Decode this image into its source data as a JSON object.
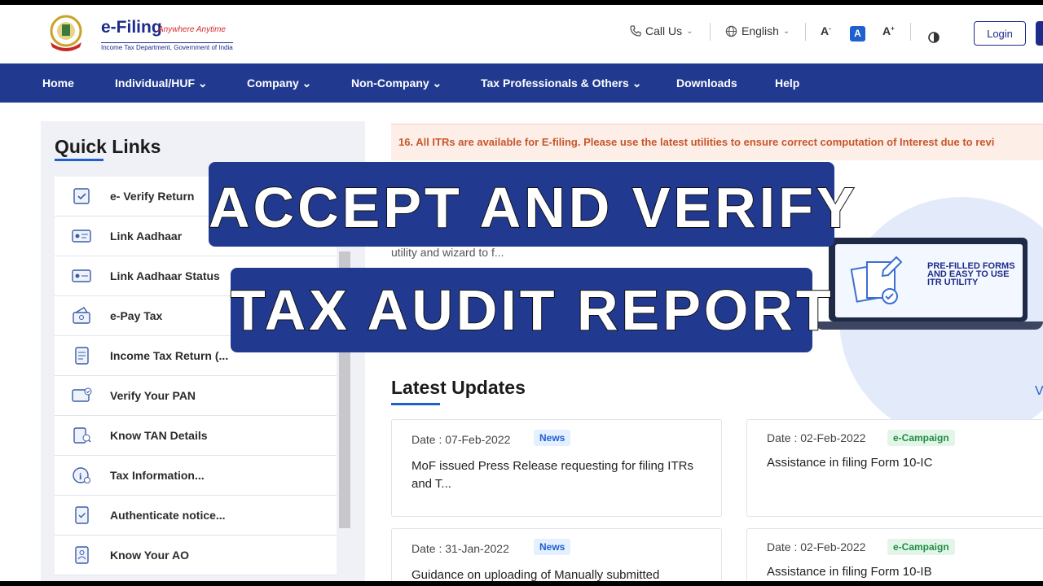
{
  "header": {
    "logo_title": "e-Filing",
    "logo_tagline": "Anywhere Anytime",
    "logo_subtitle": "Income Tax Department, Government of India",
    "call_us": "Call Us",
    "language": "English",
    "font_decrease": "A",
    "font_normal": "A",
    "font_increase": "A",
    "login": "Login"
  },
  "nav": {
    "items": [
      {
        "label": "Home"
      },
      {
        "label": "Individual/HUF ⌄"
      },
      {
        "label": "Company ⌄"
      },
      {
        "label": "Non-Company ⌄"
      },
      {
        "label": "Tax Professionals & Others ⌄"
      },
      {
        "label": "Downloads"
      },
      {
        "label": "Help"
      }
    ]
  },
  "quick_links": {
    "title": "Quick Links",
    "items": [
      {
        "label": "e- Verify Return",
        "icon": "verify-return-icon"
      },
      {
        "label": "Link Aadhaar",
        "icon": "aadhaar-card-icon"
      },
      {
        "label": "Link Aadhaar Status",
        "icon": "aadhaar-status-icon"
      },
      {
        "label": "e-Pay Tax",
        "icon": "pay-tax-icon"
      },
      {
        "label": "Income Tax Return (...",
        "icon": "return-document-icon"
      },
      {
        "label": "Verify Your PAN",
        "icon": "pan-card-icon"
      },
      {
        "label": "Know TAN Details",
        "icon": "tan-document-icon"
      },
      {
        "label": "Tax Information...",
        "icon": "info-icon"
      },
      {
        "label": "Authenticate notice...",
        "icon": "notice-document-icon"
      },
      {
        "label": "Know Your AO",
        "icon": "officer-document-icon"
      }
    ]
  },
  "notice": "16. All ITRs are available for E-filing. Please use the latest utilities to ensure correct computation of Interest due to revi",
  "hero": {
    "text": "utility and wizard to f...",
    "image_text": "PRE-FILLED FORMS AND EASY TO USE ITR UTILITY"
  },
  "latest_updates": {
    "title": "Latest Updates",
    "view_all": "V",
    "cards": [
      {
        "date": "Date : 07-Feb-2022",
        "badge": "News",
        "title": "MoF issued Press Release requesting for filing ITRs and T..."
      },
      {
        "date": "Date : 02-Feb-2022",
        "badge": "e-Campaign",
        "title": "Assistance in filing Form 10-IC"
      },
      {
        "date": "Date : 31-Jan-2022",
        "badge": "News",
        "title": "Guidance on uploading of Manually submitted"
      },
      {
        "date": "Date : 02-Feb-2022",
        "badge": "e-Campaign",
        "title": "Assistance in filing Form 10-IB"
      }
    ]
  },
  "overlay": {
    "line1": "ACCEPT AND VERIFY",
    "line2": "TAX AUDIT REPORT"
  },
  "colors": {
    "nav": "#213a8f",
    "accent": "#1f5fcf",
    "notice_text": "#c8562b"
  }
}
